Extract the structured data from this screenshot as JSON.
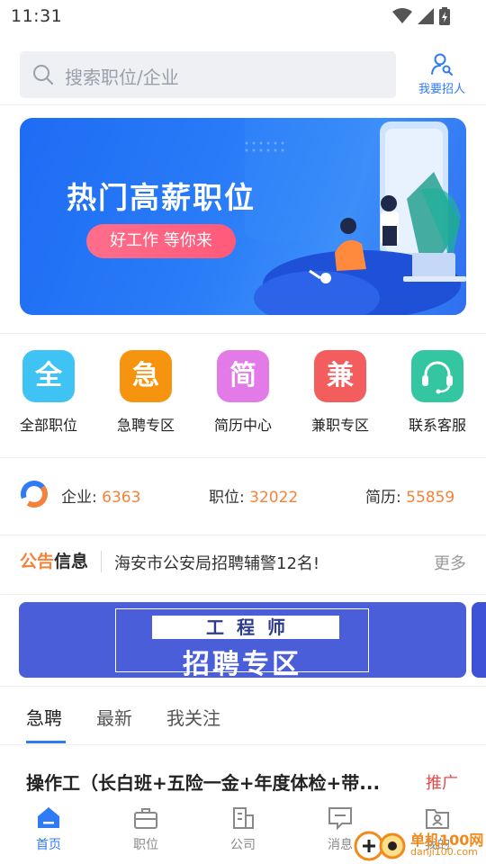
{
  "status_bar": {
    "time": "11:31"
  },
  "search": {
    "placeholder": "搜索职位/企业"
  },
  "recruit": {
    "label": "我要招人"
  },
  "banner": {
    "title": "热门高薪职位",
    "subtitle": "好工作 等你来"
  },
  "categories": [
    {
      "glyph": "全",
      "label": "全部职位",
      "color": "#3ec3f4"
    },
    {
      "glyph": "急",
      "label": "急聘专区",
      "color": "#f7940f"
    },
    {
      "glyph": "简",
      "label": "简历中心",
      "color": "#e27ae8"
    },
    {
      "glyph": "兼",
      "label": "兼职专区",
      "color": "#f45d5d"
    },
    {
      "glyph": "",
      "label": "联系客服",
      "color": "#33c6a1",
      "icon": "headset-icon"
    }
  ],
  "stats": {
    "company_label": "企业:",
    "company_value": "6363",
    "job_label": "职位:",
    "job_value": "32022",
    "resume_label": "简历:",
    "resume_value": "55859"
  },
  "notice": {
    "tag_a": "公告",
    "tag_b": "信息",
    "text": "海安市公安局招聘辅警12名!",
    "more": "更多"
  },
  "engineer_banner": {
    "top": "工程师",
    "bottom": "招聘专区"
  },
  "tabs": [
    {
      "label": "急聘",
      "active": true
    },
    {
      "label": "最新",
      "active": false
    },
    {
      "label": "我关注",
      "active": false
    }
  ],
  "job": {
    "title": "操作工（长白班+五险一金+年度体检+带...",
    "badge": "推广"
  },
  "bottom_nav": [
    {
      "label": "首页",
      "icon": "home-icon",
      "active": true
    },
    {
      "label": "职位",
      "icon": "briefcase-icon",
      "active": false
    },
    {
      "label": "公司",
      "icon": "building-icon",
      "active": false
    },
    {
      "label": "消息",
      "icon": "message-icon",
      "active": false
    },
    {
      "label": "我的",
      "icon": "profile-icon",
      "active": false
    }
  ],
  "watermark": {
    "text": "单机100网",
    "sub": "danji100.com"
  },
  "colors": {
    "accent": "#2f7bf6",
    "orange": "#f5823a",
    "promo": "#e8484b"
  }
}
